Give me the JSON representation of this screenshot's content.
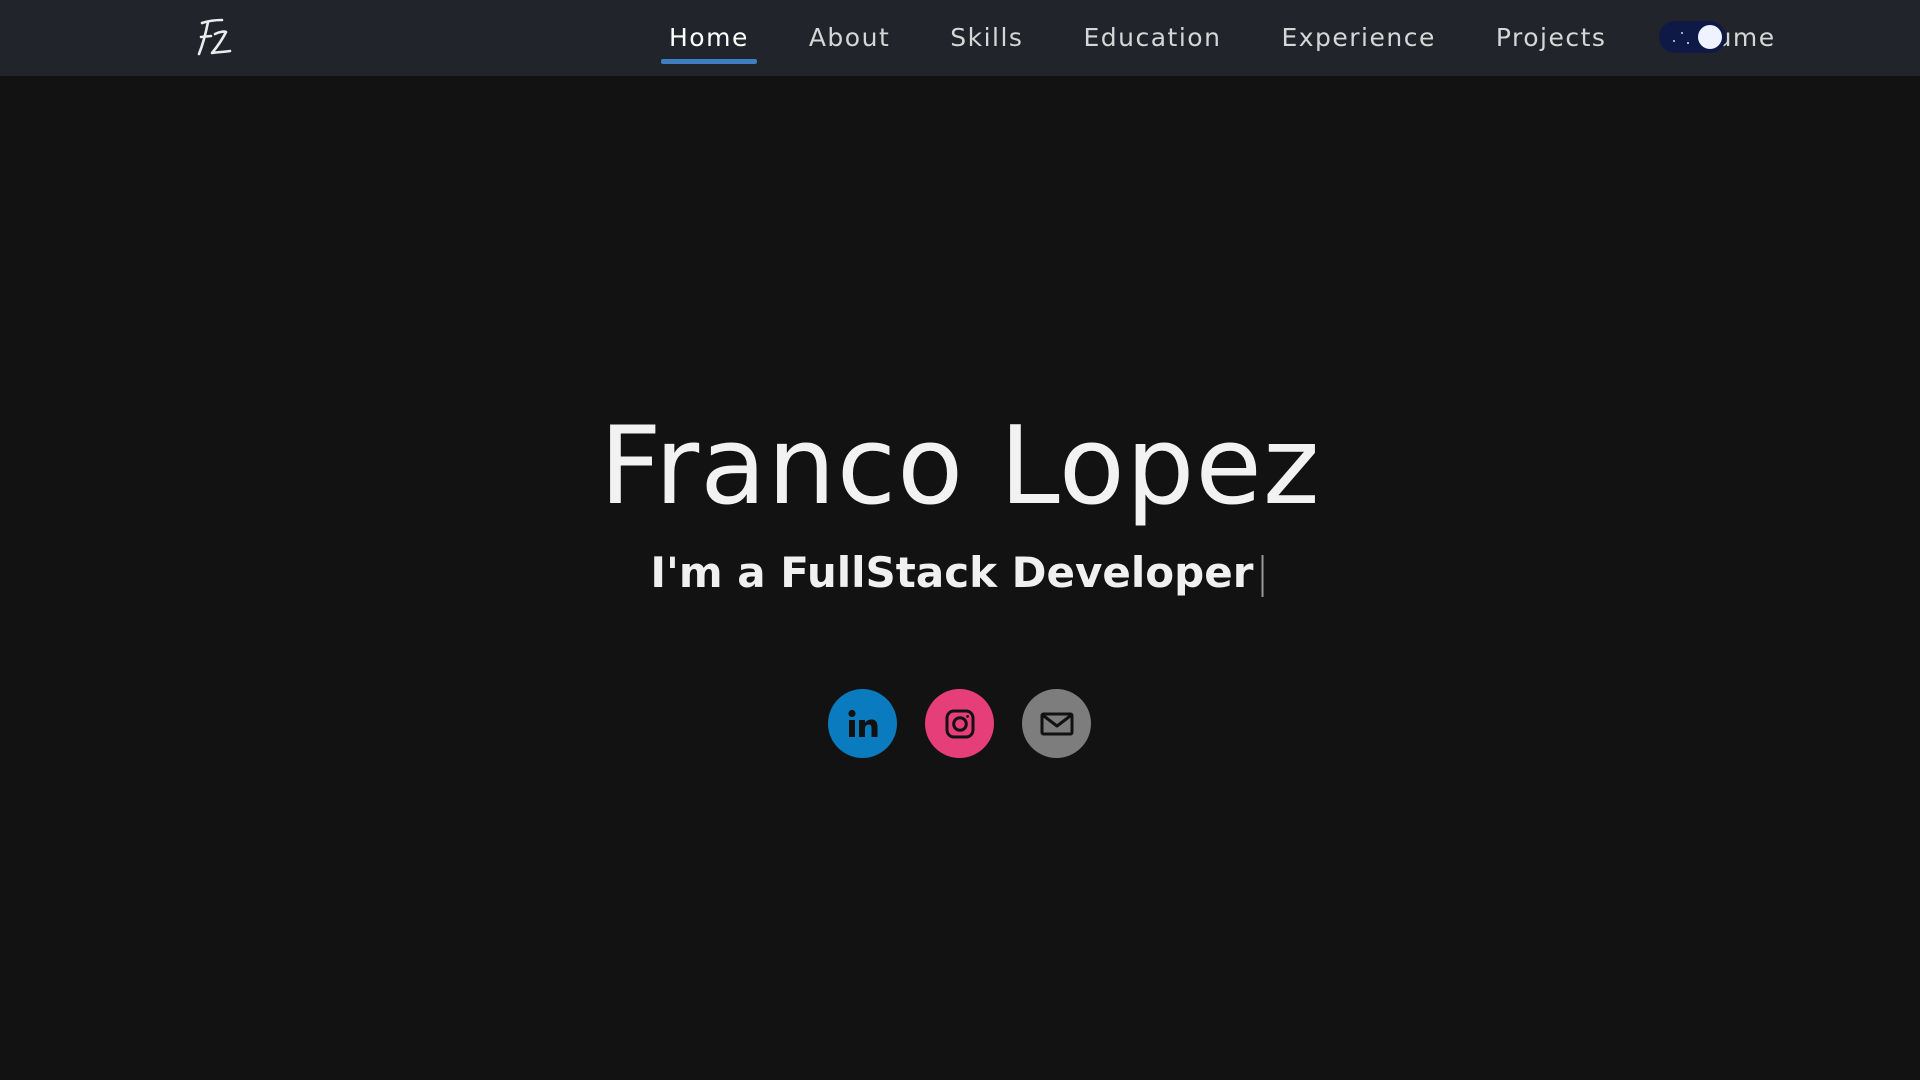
{
  "nav": {
    "logo_icon": "fl-signature-logo-icon",
    "items": [
      {
        "label": "Home",
        "active": true
      },
      {
        "label": "About",
        "active": false
      },
      {
        "label": "Skills",
        "active": false
      },
      {
        "label": "Education",
        "active": false
      },
      {
        "label": "Experience",
        "active": false
      },
      {
        "label": "Projects",
        "active": false
      },
      {
        "label": "Resume",
        "active": false
      }
    ],
    "theme_toggle": {
      "icon": "moon-stars-icon",
      "state": "dark"
    }
  },
  "hero": {
    "name": "Franco Lopez",
    "tagline_prefix": "I'm a ",
    "tagline_role": "FullStack Developer",
    "cursor": "|"
  },
  "socials": [
    {
      "name": "LinkedIn",
      "icon": "linkedin-icon",
      "color": "#0a7bbf"
    },
    {
      "name": "Instagram",
      "icon": "instagram-icon",
      "color": "#e63e78"
    },
    {
      "name": "Email",
      "icon": "mail-icon",
      "color": "#7d7d7d"
    }
  ],
  "colors": {
    "background": "#121212",
    "navbar": "#21252b",
    "accent": "#3d7fc1"
  }
}
